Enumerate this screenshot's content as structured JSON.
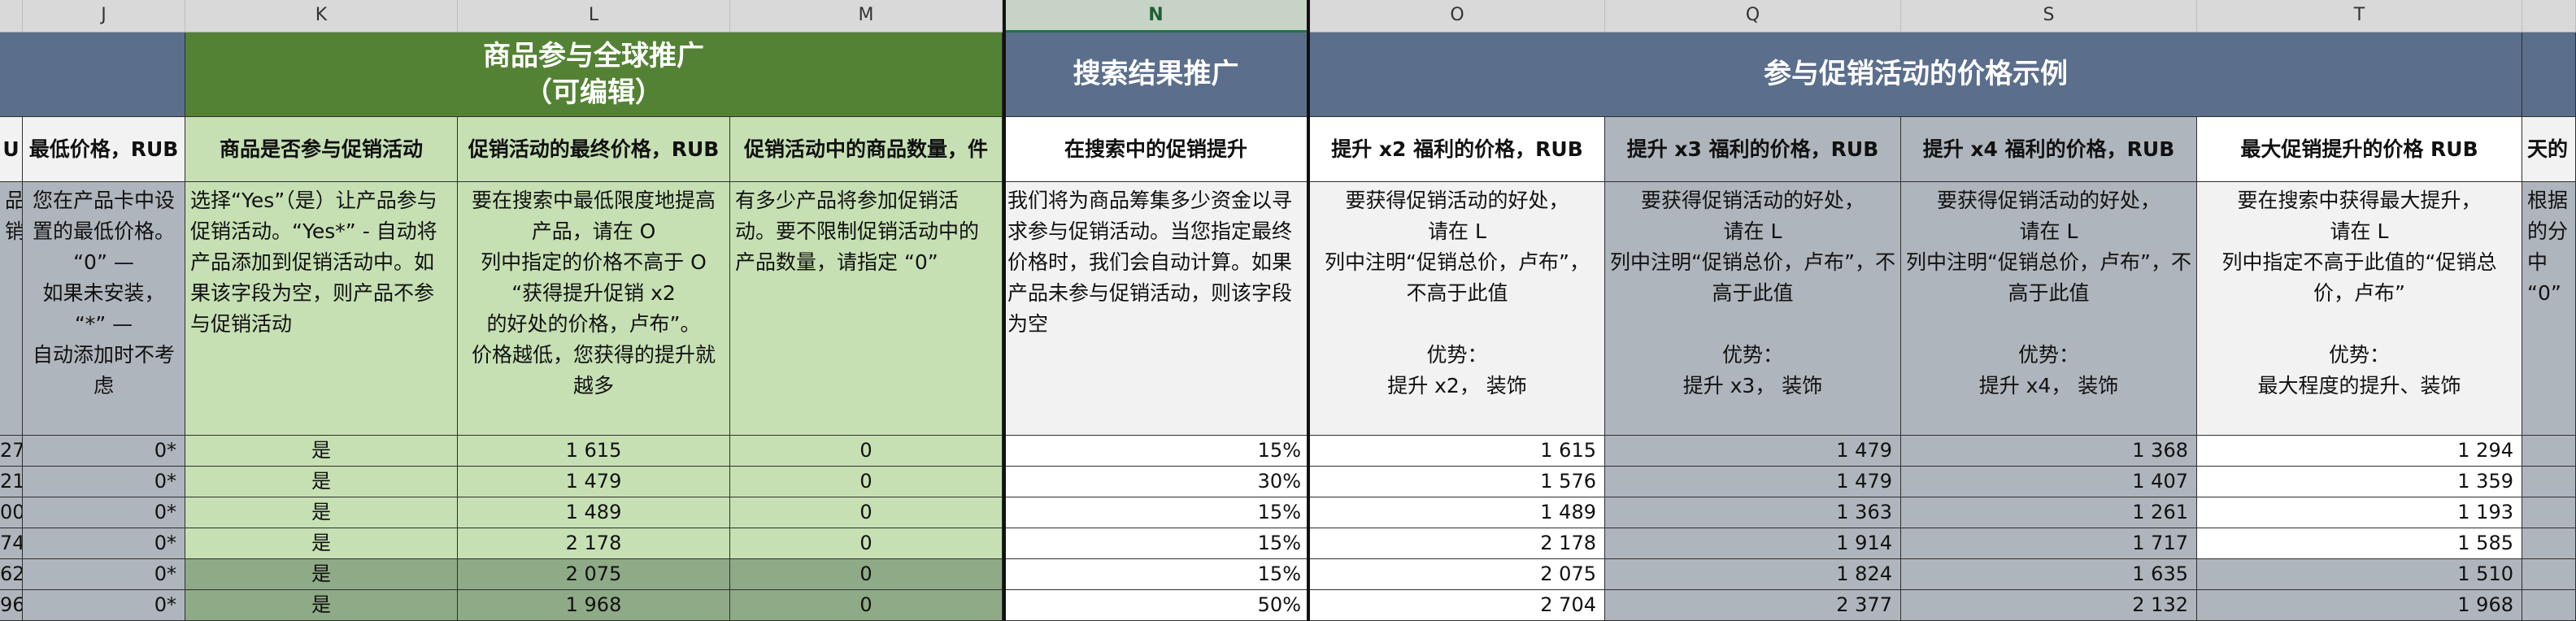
{
  "columns": [
    "J",
    "K",
    "L",
    "M",
    "N",
    "O",
    "Q",
    "S",
    "T"
  ],
  "left_partial": {
    "col_header": "",
    "header": "U",
    "desc": "品\n销",
    "rows": [
      "27",
      "21",
      "00",
      "74",
      "62",
      "96"
    ]
  },
  "bands": {
    "green": "商品参与全球推广\n（可编辑）",
    "search": "搜索结果推广",
    "price_examples": "参与促销活动的价格示例"
  },
  "headers": {
    "j": "最低价格，RUB",
    "k": "商品是否参与促销活动",
    "l": "促销活动的最终价格，RUB",
    "m": "促销活动中的商品数量，件",
    "n": "在搜索中的促销提升",
    "o": "提升 x2 福利的价格，RUB",
    "q": "提升 x3 福利的价格，RUB",
    "s": "提升 x4 福利的价格，RUB",
    "t": "最大促销提升的价格 RUB",
    "u_partial": "天的"
  },
  "descriptions": {
    "j": "您在产品卡中设置的最低价格。\n“0” —\n如果未安装，\n“*” —\n自动添加时不考虑",
    "k": "选择“Yes”（是）让产品参与促销活动。“Yes*” - 自动将产品添加到促销活动中。如果该字段为空，则产品不参与促销活动",
    "l": "要在搜索中最低限度地提高产品，请在 O\n列中指定的价格不高于 O “获得提升促销 x2\n的好处的价格，卢布”。\n价格越低，您获得的提升就越多",
    "m": "有多少产品将参加促销活动。要不限制促销活动中的产品数量，请指定 “0”",
    "n": "我们将为商品筹集多少资金以寻求参与促销活动。当您指定最终价格时，我们会自动计算。如果产品未参与促销活动，则该字段为空",
    "o": "要获得促销活动的好处，\n请在 L\n列中注明“促销总价，卢布”，不高于此值\n\n优势：\n提升 x2， 装饰",
    "q": "要获得促销活动的好处，\n请在 L\n列中注明“促销总价，卢布”，不高于此值\n\n优势：\n提升 x3， 装饰",
    "s": "要获得促销活动的好处，\n请在 L\n列中注明“促销总价，卢布”，不高于此值\n\n优势：\n提升 x4， 装饰",
    "t": "要在搜索中获得最大提升，\n请在 L\n列中指定不高于此值的“促销总价，卢布”\n\n优势：\n最大程度的提升、装饰",
    "u_partial": "根据\n的分\n中\n“0”"
  },
  "rows": [
    {
      "j": "0*",
      "k": "是",
      "l": "1 615",
      "m": "0",
      "n": "15%",
      "o": "1 615",
      "q": "1 479",
      "s": "1 368",
      "t": "1 294"
    },
    {
      "j": "0*",
      "k": "是",
      "l": "1 479",
      "m": "0",
      "n": "30%",
      "o": "1 576",
      "q": "1 479",
      "s": "1 407",
      "t": "1 359"
    },
    {
      "j": "0*",
      "k": "是",
      "l": "1 489",
      "m": "0",
      "n": "15%",
      "o": "1 489",
      "q": "1 363",
      "s": "1 261",
      "t": "1 193"
    },
    {
      "j": "0*",
      "k": "是",
      "l": "2 178",
      "m": "0",
      "n": "15%",
      "o": "2 178",
      "q": "1 914",
      "s": "1 717",
      "t": "1 585"
    },
    {
      "j": "0*",
      "k": "是",
      "l": "2 075",
      "m": "0",
      "n": "15%",
      "o": "2 075",
      "q": "1 824",
      "s": "1 635",
      "t": "1 510"
    },
    {
      "j": "0*",
      "k": "是",
      "l": "1 968",
      "m": "0",
      "n": "50%",
      "o": "2 704",
      "q": "2 377",
      "s": "2 132",
      "t": "1 968"
    }
  ],
  "colors": {
    "green_band": "#548235",
    "green_light": "#c6e0b4",
    "green_dark": "#8faa86",
    "blue_band": "#5b6e8c",
    "gray_cell": "#aeb5bd"
  }
}
